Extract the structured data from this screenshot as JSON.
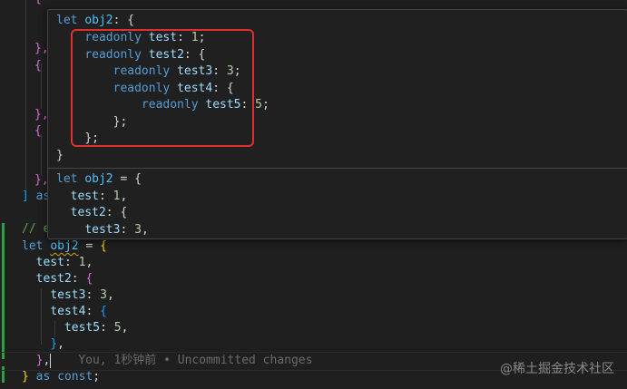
{
  "editor": {
    "hidden_top_lines": [
      "{",
      "},",
      "{",
      "},",
      "{",
      "},",
      "] as"
    ],
    "comment_fragment": "// e",
    "code": {
      "let_kw": "let",
      "var_name": "obj2",
      "eq": " = ",
      "open": "{",
      "test": "test",
      "test_val": "1",
      "test2": "test2",
      "test3": "test3",
      "test3_val": "3",
      "test4": "test4",
      "test5": "test5",
      "test5_val": "5",
      "as_kw": "as",
      "const_kw": "const"
    },
    "blame": "You, 1秒钟前 • Uncommitted changes"
  },
  "hover": {
    "type_sig": {
      "head_kw": "let",
      "head_var": "obj2",
      "readonly": "readonly",
      "test": "test",
      "test_val": "1",
      "test2": "test2",
      "test3": "test3",
      "test3_val": "3",
      "test4": "test4",
      "test5": "test5",
      "test5_val": "5"
    },
    "preview": {
      "kw": "let",
      "var": "obj2",
      "test": "test",
      "test_val": "1",
      "test2": "test2",
      "test3": "test3",
      "test3_val": "3"
    }
  },
  "watermark": "@稀土掘金技术社区",
  "colors": {
    "highlight_box": "#e0302e",
    "editor_bg": "#1f1f1f",
    "git_added_bar": "#2ea043"
  }
}
